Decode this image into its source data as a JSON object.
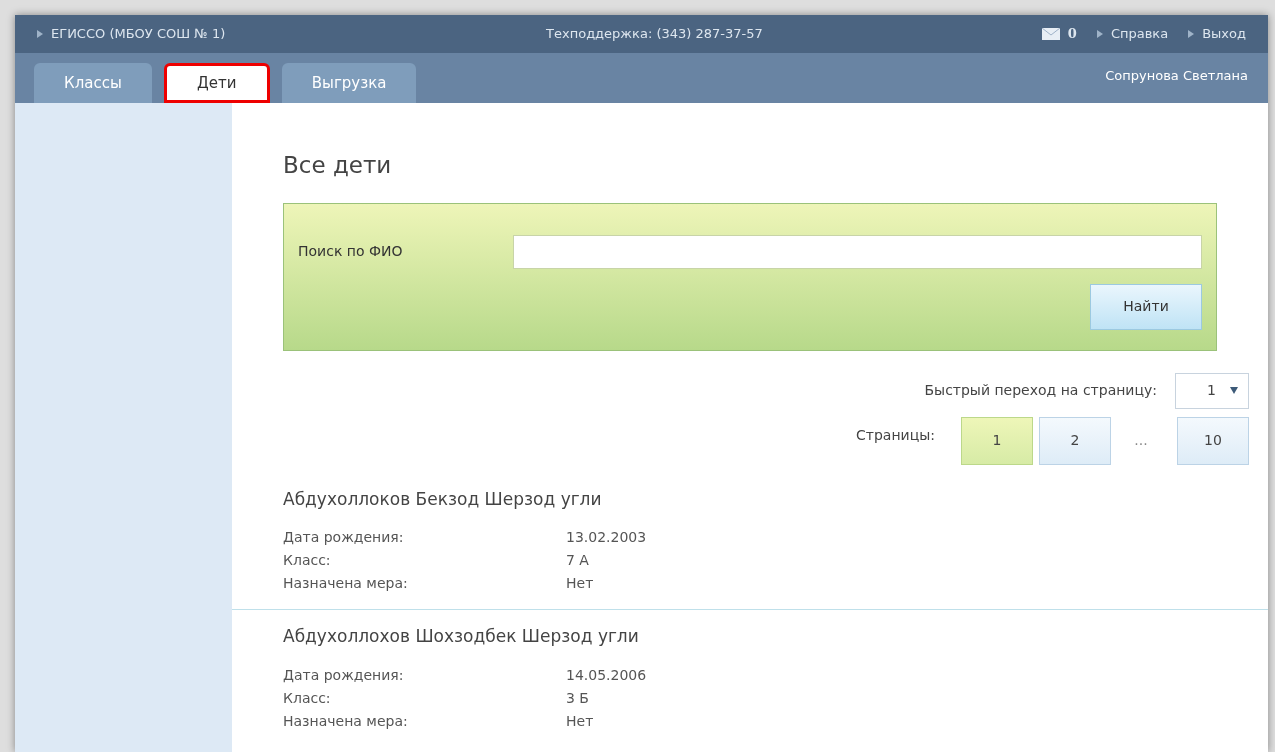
{
  "header": {
    "title": "ЕГИССО (МБОУ СОШ № 1)",
    "support": "Техподдержка: (343) 287-37-57",
    "messages": "0",
    "links": [
      "Справка",
      "Выход"
    ]
  },
  "tabs": [
    {
      "label": "Классы",
      "selected": false,
      "highlighted": false
    },
    {
      "label": "Дети",
      "selected": true,
      "highlighted": true
    },
    {
      "label": "Выгрузка",
      "selected": false,
      "highlighted": false
    }
  ],
  "user": "Сопрунова Светлана",
  "page_title": "Все дети",
  "search": {
    "label": "Поиск по ФИО",
    "button": "Найти"
  },
  "quick_jump": {
    "label": "Быстрый переход на страницу:",
    "value": "1"
  },
  "pages": {
    "label": "Страницы:",
    "items": [
      {
        "kind": "page",
        "label": "1",
        "selected": true
      },
      {
        "kind": "page",
        "label": "2",
        "selected": false
      },
      {
        "kind": "gap",
        "label": "..."
      },
      {
        "kind": "page",
        "label": "10",
        "selected": false
      }
    ]
  },
  "children": [
    {
      "name": "Абдухоллоков Бекзод Шерзод угли",
      "fields": [
        {
          "label": "Дата рождения:",
          "value": "13.02.2003"
        },
        {
          "label": "Класс:",
          "value": "7 А"
        },
        {
          "label": "Назначена мера:",
          "value": "Нет"
        }
      ]
    },
    {
      "name": "Абдухоллохов Шохзодбек Шерзод угли",
      "fields": [
        {
          "label": "Дата рождения:",
          "value": "14.05.2006"
        },
        {
          "label": "Класс:",
          "value": "3 Б"
        },
        {
          "label": "Назначена мера:",
          "value": "Нет"
        }
      ]
    }
  ]
}
